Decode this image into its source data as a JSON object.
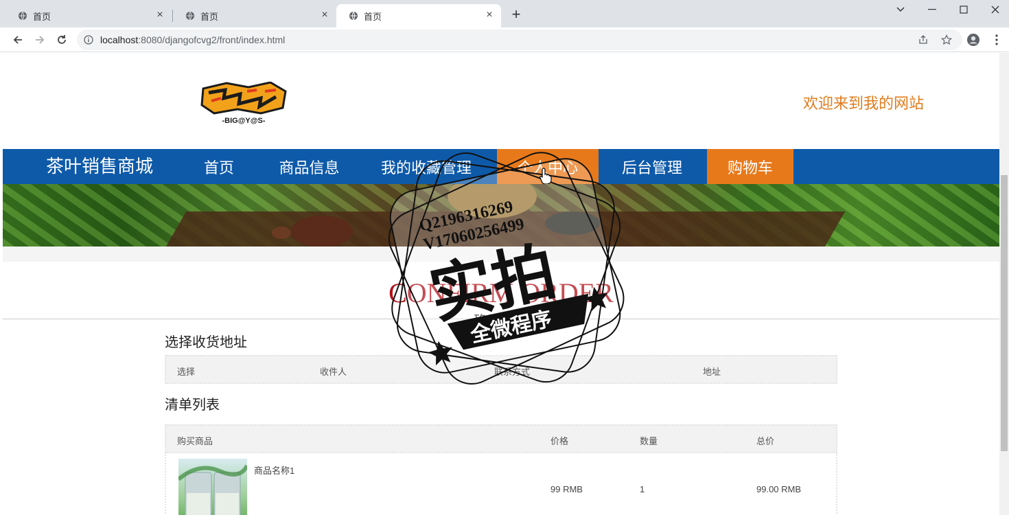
{
  "browser": {
    "tabs": [
      {
        "title": "首页",
        "active": false
      },
      {
        "title": "首页",
        "active": false
      },
      {
        "title": "首页",
        "active": true
      }
    ],
    "url_host": "localhost",
    "url_rest": ":8080/djangofcvg2/front/index.html"
  },
  "header": {
    "logo_text": "-BIG@Y@S-",
    "welcome": "欢迎来到我的网站"
  },
  "nav": {
    "brand": "茶叶销售商城",
    "items": [
      {
        "label": "首页",
        "highlight": false
      },
      {
        "label": "商品信息",
        "highlight": false
      },
      {
        "label": "我的收藏管理",
        "highlight": false
      },
      {
        "label": "个人中心",
        "highlight": true
      },
      {
        "label": "后台管理",
        "highlight": false
      },
      {
        "label": "购物车",
        "highlight": true
      }
    ]
  },
  "colors": {
    "nav_bg": "#0e5aa9",
    "nav_highlight": "#e8791b",
    "title_red": "#b0121a",
    "welcome_orange": "#e07b1c"
  },
  "page": {
    "title": "CONFIRM ORDER",
    "subtitle": "确认订单"
  },
  "address": {
    "section_title": "选择收货地址",
    "columns": [
      "选择",
      "收件人",
      "联系方式",
      "地址"
    ]
  },
  "order": {
    "section_title": "清单列表",
    "columns": [
      "购买商品",
      "价格",
      "数量",
      "总价"
    ],
    "rows": [
      {
        "name": "商品名称1",
        "price": "99 RMB",
        "qty": "1",
        "total": "99.00 RMB"
      }
    ]
  },
  "watermark": {
    "line1": "Q2196316269",
    "line2": "V17060256499",
    "main": "实拍",
    "ribbon": "全微程序"
  }
}
